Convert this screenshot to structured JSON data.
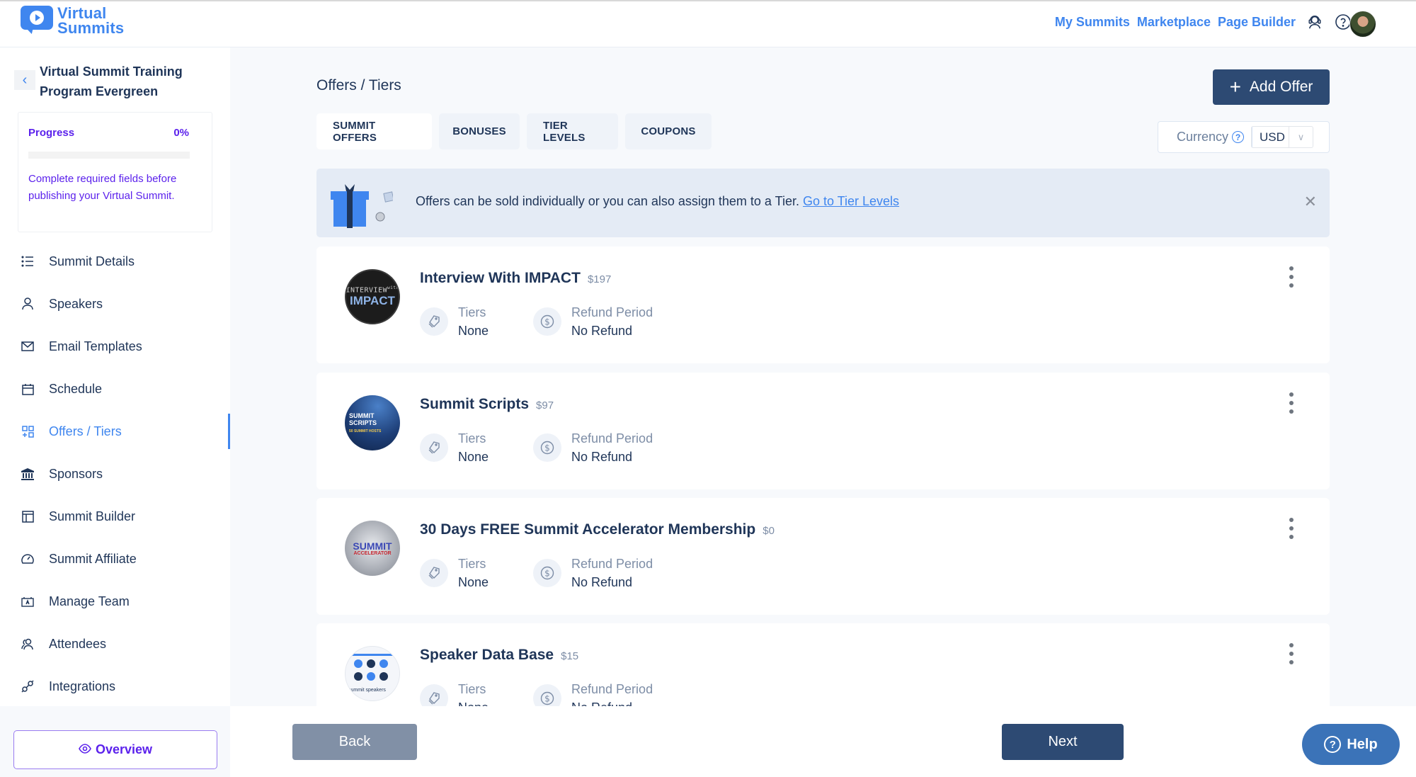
{
  "header": {
    "logo_line1": "Virtual",
    "logo_line2": "Summits",
    "nav": [
      "My Summits",
      "Marketplace",
      "Page Builder"
    ],
    "icons": [
      "support-headset-icon",
      "help-circle-icon"
    ]
  },
  "sidebar": {
    "summit_title": "Virtual Summit Training Program Evergreen",
    "progress": {
      "label": "Progress",
      "value_text": "0%",
      "value": 0,
      "message": "Complete required fields before publishing your Virtual Summit."
    },
    "items": [
      {
        "label": "Summit Details",
        "icon": "list-icon"
      },
      {
        "label": "Speakers",
        "icon": "user-icon"
      },
      {
        "label": "Email Templates",
        "icon": "mail-icon"
      },
      {
        "label": "Schedule",
        "icon": "calendar-icon"
      },
      {
        "label": "Offers / Tiers",
        "icon": "grid-plus-icon",
        "active": true
      },
      {
        "label": "Sponsors",
        "icon": "bank-icon"
      },
      {
        "label": "Summit Builder",
        "icon": "layout-icon"
      },
      {
        "label": "Summit Affiliate",
        "icon": "gauge-icon"
      },
      {
        "label": "Manage Team",
        "icon": "team-board-icon"
      },
      {
        "label": "Attendees",
        "icon": "users-icon"
      },
      {
        "label": "Integrations",
        "icon": "plug-icon"
      }
    ],
    "overview_label": "Overview"
  },
  "main": {
    "title": "Offers / Tiers",
    "add_offer_label": "Add Offer",
    "tabs": [
      {
        "label": "SUMMIT OFFERS",
        "active": true
      },
      {
        "label": "BONUSES"
      },
      {
        "label": "TIER LEVELS"
      },
      {
        "label": "COUPONS"
      }
    ],
    "currency": {
      "label": "Currency",
      "value": "USD"
    },
    "banner": {
      "text": "Offers can be sold individually or you can also assign them to a Tier.",
      "link": "Go to Tier Levels"
    },
    "meta_labels": {
      "tiers": "Tiers",
      "refund": "Refund Period"
    },
    "offers": [
      {
        "name": "Interview With IMPACT",
        "price": "$197",
        "tiers": "None",
        "refund": "No Refund",
        "image": "Interview with IMPACT"
      },
      {
        "name": "Summit Scripts",
        "price": "$97",
        "tiers": "None",
        "refund": "No Refund",
        "image": "Summit Scripts"
      },
      {
        "name": "30 Days FREE Summit Accelerator Membership",
        "price": "$0",
        "tiers": "None",
        "refund": "No Refund",
        "image": "Summit Accelerator"
      },
      {
        "name": "Speaker Data Base",
        "price": "$15",
        "tiers": "None",
        "refund": "No Refund",
        "image": "summit speakers"
      }
    ]
  },
  "footer": {
    "back_label": "Back",
    "next_label": "Next",
    "help_label": "Help"
  },
  "colors": {
    "brand_blue": "#3f86ef",
    "navy": "#2d4a73",
    "purple": "#5b21ec",
    "help_blue": "#3b73b8"
  }
}
